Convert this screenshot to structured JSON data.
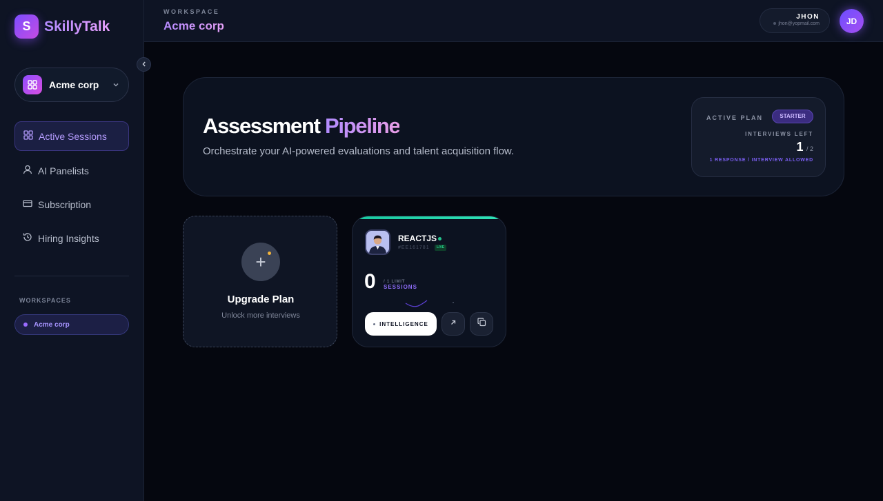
{
  "brand": {
    "logo_letter": "S",
    "name": "SkillyTalk"
  },
  "sidebar": {
    "workspace_select": "Acme corp",
    "nav": [
      {
        "label": "Active Sessions",
        "icon": "grid-icon",
        "active": true
      },
      {
        "label": "AI Panelists",
        "icon": "user-icon"
      },
      {
        "label": "Subscription",
        "icon": "card-icon"
      },
      {
        "label": "Hiring Insights",
        "icon": "history-icon"
      }
    ],
    "workspaces_heading": "WORKSPACES",
    "workspaces": [
      {
        "label": "Acme corp"
      }
    ]
  },
  "header": {
    "eyebrow": "WORKSPACE",
    "title": "Acme corp",
    "user": {
      "name": "JHON",
      "email": "jhon@yopmail.com",
      "initials": "JD"
    }
  },
  "hero": {
    "title_main": "Assessment",
    "title_accent": "Pipeline",
    "subtitle": "Orchestrate your AI-powered evaluations and talent acquisition flow.",
    "plan": {
      "label": "ACTIVE PLAN",
      "badge": "STARTER",
      "interviews_label": "INTERVIEWS LEFT",
      "interviews_left": "1",
      "interviews_total": "/ 2",
      "note": "1 RESPONSE / INTERVIEW ALLOWED"
    }
  },
  "upgrade_card": {
    "plus": "+",
    "title": "Upgrade Plan",
    "subtitle": "Unlock more interviews"
  },
  "session_card": {
    "title": "REACTJS",
    "id": "#EE161781",
    "live": "LIVE",
    "count": "0",
    "limit": "/ 1 LIMIT",
    "sessions_label": "SESSIONS",
    "intelligence_label": "INTELLIGENCE",
    "accent_color": "#1fd3a8"
  }
}
